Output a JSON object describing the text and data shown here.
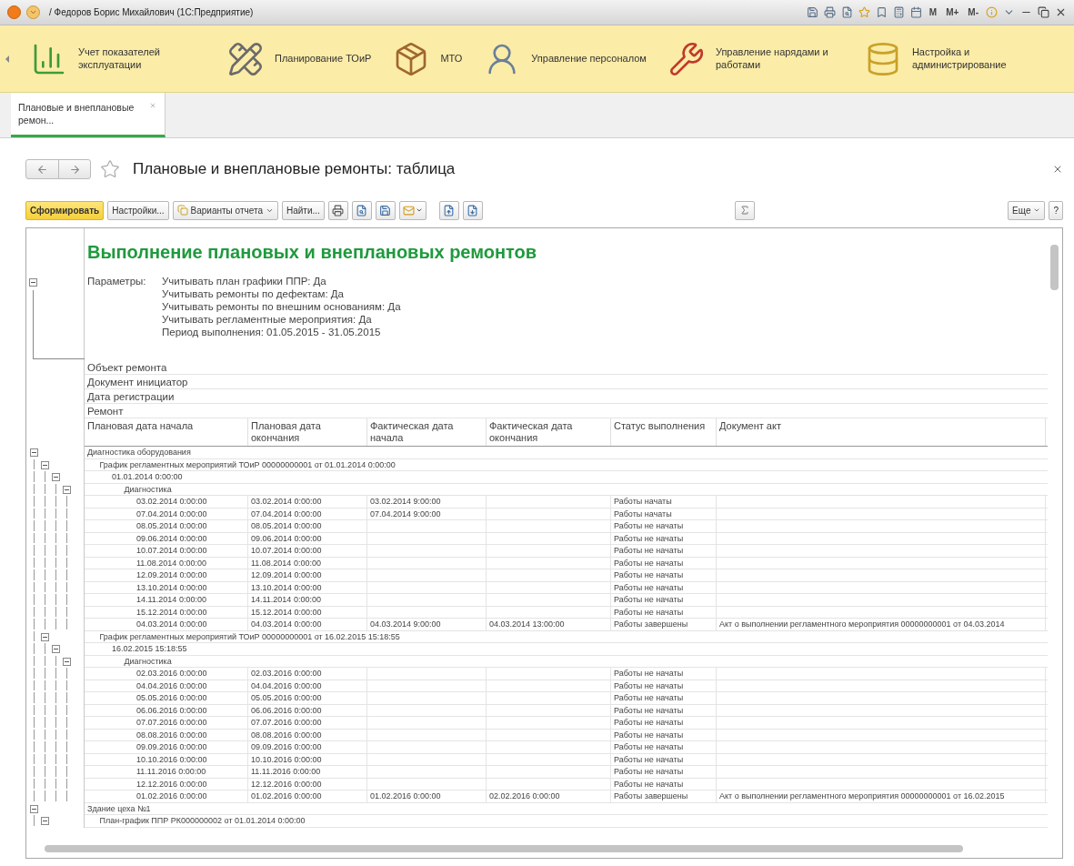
{
  "window": {
    "title": "/ Федоров Борис Михайлович  (1С:Предприятие)",
    "memory_buttons": [
      "M",
      "M+",
      "M-"
    ]
  },
  "sections": [
    {
      "label": "Учет показателей эксплуатации",
      "kind": "chart"
    },
    {
      "label": "Планирование ТОиР",
      "kind": "tools"
    },
    {
      "label": "МТО",
      "kind": "boxes"
    },
    {
      "label": "Управление персоналом",
      "kind": "person"
    },
    {
      "label": "Управление нарядами и работами",
      "kind": "wrench"
    },
    {
      "label": "Настройка и администрирование",
      "kind": "database"
    }
  ],
  "tabs": [
    {
      "label": "Плановые и внеплановые ремон...",
      "selected": true
    }
  ],
  "form": {
    "title": "Плановые и внеплановые ремонты: таблица",
    "buttons": [
      {
        "kind": "primary",
        "label": "Сформировать"
      },
      {
        "kind": "text",
        "label": "Настройки..."
      },
      {
        "kind": "variants",
        "label": "Варианты отчета"
      },
      {
        "kind": "text",
        "label": "Найти..."
      }
    ],
    "more_button": "Еще",
    "help_button": "?"
  },
  "report": {
    "title": "Выполнение плановых и внеплановых ремонтов",
    "parameters_label": "Параметры:",
    "parameters": [
      "Учитывать план графики ППР: Да",
      "Учитывать ремонты по дефектам: Да",
      "Учитывать ремонты по внешним основаниям: Да",
      "Учитывать регламентные мероприятия: Да",
      "Период выполнения: 01.05.2015 - 31.05.2015"
    ],
    "grouping_headers": [
      "Объект ремонта",
      "Документ инициатор",
      "Дата регистрации",
      "Ремонт"
    ],
    "columns": [
      "Плановая дата начала",
      "Плановая дата окончания",
      "Фактическая дата начала",
      "Фактическая дата окончания",
      "Статус выполнения",
      "Документ акт"
    ],
    "groups": [
      {
        "label": "Диагностика оборудования",
        "expanded": true,
        "children": [
          {
            "label": "График регламентных мероприятий ТОиР 00000000001 от 01.01.2014 0:00:00",
            "expanded": true,
            "children": [
              {
                "label": "01.01.2014 0:00:00",
                "expanded": true,
                "children": [
                  {
                    "label": "Диагностика",
                    "expanded": true,
                    "rows": [
                      [
                        "03.02.2014 0:00:00",
                        "03.02.2014 0:00:00",
                        "03.02.2014 9:00:00",
                        null,
                        "Работы начаты",
                        null
                      ],
                      [
                        "07.04.2014 0:00:00",
                        "07.04.2014 0:00:00",
                        "07.04.2014 9:00:00",
                        null,
                        "Работы начаты",
                        null
                      ],
                      [
                        "08.05.2014 0:00:00",
                        "08.05.2014 0:00:00",
                        null,
                        null,
                        "Работы не начаты",
                        null
                      ],
                      [
                        "09.06.2014 0:00:00",
                        "09.06.2014 0:00:00",
                        null,
                        null,
                        "Работы не начаты",
                        null
                      ],
                      [
                        "10.07.2014 0:00:00",
                        "10.07.2014 0:00:00",
                        null,
                        null,
                        "Работы не начаты",
                        null
                      ],
                      [
                        "11.08.2014 0:00:00",
                        "11.08.2014 0:00:00",
                        null,
                        null,
                        "Работы не начаты",
                        null
                      ],
                      [
                        "12.09.2014 0:00:00",
                        "12.09.2014 0:00:00",
                        null,
                        null,
                        "Работы не начаты",
                        null
                      ],
                      [
                        "13.10.2014 0:00:00",
                        "13.10.2014 0:00:00",
                        null,
                        null,
                        "Работы не начаты",
                        null
                      ],
                      [
                        "14.11.2014 0:00:00",
                        "14.11.2014 0:00:00",
                        null,
                        null,
                        "Работы не начаты",
                        null
                      ],
                      [
                        "15.12.2014 0:00:00",
                        "15.12.2014 0:00:00",
                        null,
                        null,
                        "Работы не начаты",
                        null
                      ],
                      [
                        "04.03.2014 0:00:00",
                        "04.03.2014 0:00:00",
                        "04.03.2014 9:00:00",
                        "04.03.2014 13:00:00",
                        "Работы завершены",
                        "Акт о выполнении регламентного мероприятия 00000000001 от 04.03.2014"
                      ]
                    ]
                  }
                ]
              }
            ]
          },
          {
            "label": "График регламентных мероприятий ТОиР 00000000001 от 16.02.2015 15:18:55",
            "expanded": true,
            "children": [
              {
                "label": "16.02.2015 15:18:55",
                "expanded": true,
                "children": [
                  {
                    "label": "Диагностика",
                    "expanded": true,
                    "rows": [
                      [
                        "02.03.2016 0:00:00",
                        "02.03.2016 0:00:00",
                        null,
                        null,
                        "Работы не начаты",
                        null
                      ],
                      [
                        "04.04.2016 0:00:00",
                        "04.04.2016 0:00:00",
                        null,
                        null,
                        "Работы не начаты",
                        null
                      ],
                      [
                        "05.05.2016 0:00:00",
                        "05.05.2016 0:00:00",
                        null,
                        null,
                        "Работы не начаты",
                        null
                      ],
                      [
                        "06.06.2016 0:00:00",
                        "06.06.2016 0:00:00",
                        null,
                        null,
                        "Работы не начаты",
                        null
                      ],
                      [
                        "07.07.2016 0:00:00",
                        "07.07.2016 0:00:00",
                        null,
                        null,
                        "Работы не начаты",
                        null
                      ],
                      [
                        "08.08.2016 0:00:00",
                        "08.08.2016 0:00:00",
                        null,
                        null,
                        "Работы не начаты",
                        null
                      ],
                      [
                        "09.09.2016 0:00:00",
                        "09.09.2016 0:00:00",
                        null,
                        null,
                        "Работы не начаты",
                        null
                      ],
                      [
                        "10.10.2016 0:00:00",
                        "10.10.2016 0:00:00",
                        null,
                        null,
                        "Работы не начаты",
                        null
                      ],
                      [
                        "11.11.2016 0:00:00",
                        "11.11.2016 0:00:00",
                        null,
                        null,
                        "Работы не начаты",
                        null
                      ],
                      [
                        "12.12.2016 0:00:00",
                        "12.12.2016 0:00:00",
                        null,
                        null,
                        "Работы не начаты",
                        null
                      ],
                      [
                        "01.02.2016 0:00:00",
                        "01.02.2016 0:00:00",
                        "01.02.2016 0:00:00",
                        "02.02.2016 0:00:00",
                        "Работы завершены",
                        "Акт о выполнении регламентного мероприятия 00000000001 от 16.02.2015"
                      ]
                    ]
                  }
                ]
              }
            ]
          }
        ]
      },
      {
        "label": "Здание цеха №1",
        "expanded": true,
        "children": [
          {
            "label": "План-график ППР РК000000002 от 01.01.2014 0:00:00",
            "expanded": true
          }
        ]
      }
    ]
  }
}
